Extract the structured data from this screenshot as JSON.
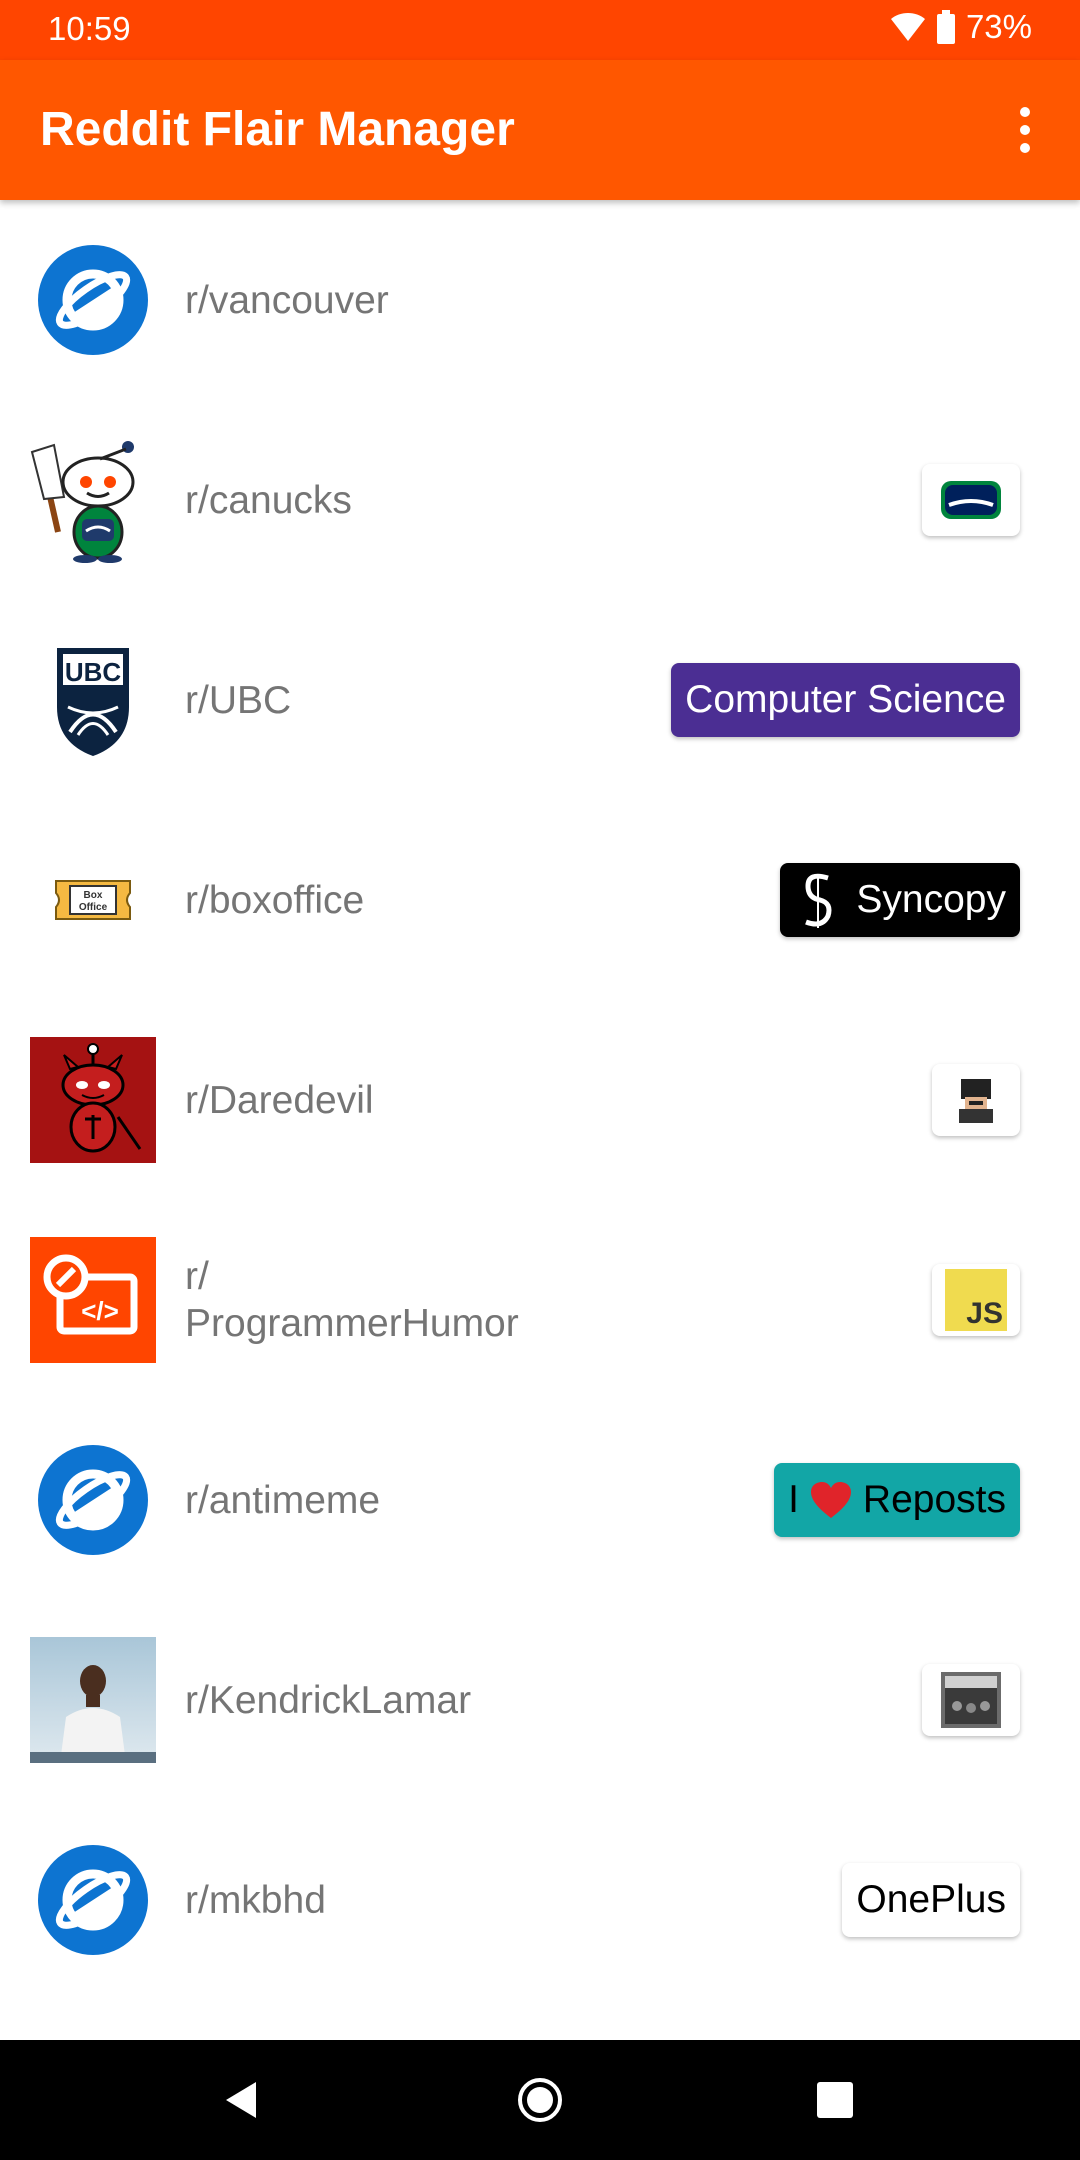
{
  "status": {
    "time": "10:59",
    "battery": "73%"
  },
  "app": {
    "title": "Reddit Flair Manager"
  },
  "subreddits": [
    {
      "name": "r/vancouver"
    },
    {
      "name": "r/canucks"
    },
    {
      "name": "r/UBC",
      "flair": "Computer Science"
    },
    {
      "name": "r/boxoffice",
      "flair": "Syncopy"
    },
    {
      "name": "r/Daredevil"
    },
    {
      "name": "r/\nProgrammerHumor",
      "flair_icon_text": "JS"
    },
    {
      "name": "r/antimeme",
      "flair_prefix": "I",
      "flair": "Reposts"
    },
    {
      "name": "r/KendrickLamar"
    },
    {
      "name": "r/mkbhd",
      "flair": "OnePlus"
    }
  ],
  "icons": {
    "avatar_badges": {
      "ubc": "UBC",
      "boxoffice": "Box\nOffice"
    }
  },
  "colors": {
    "status_bar": "#ff4500",
    "app_bar": "#ff5700",
    "default_avatar": "#0d74d1",
    "ubc_flair": "#4b2e93",
    "antimeme_flair": "#12a6a6"
  }
}
